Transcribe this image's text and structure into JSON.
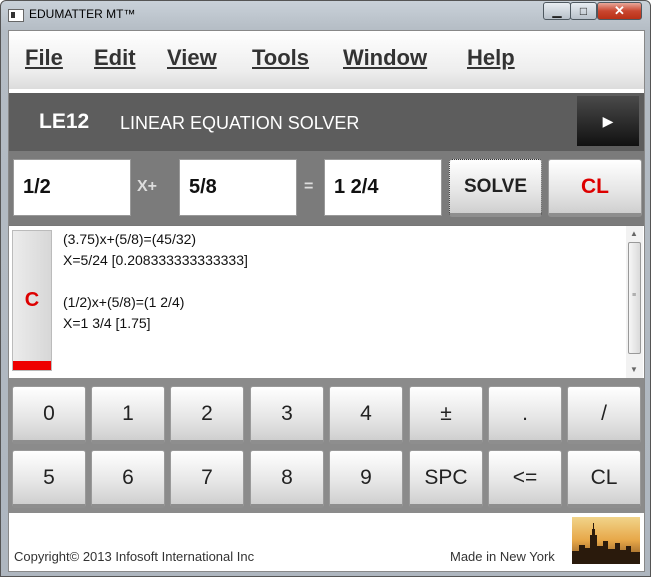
{
  "window": {
    "title": "EDUMATTER MT™",
    "controls": {
      "minimize": "▁",
      "maximize": "□",
      "close": "✕"
    }
  },
  "menu": [
    "File",
    "Edit",
    "View",
    "Tools",
    "Window",
    "Help"
  ],
  "header": {
    "code": "LE12",
    "name": "LINEAR EQUATION SOLVER",
    "next_icon": "▶"
  },
  "equation": {
    "a": "1/2",
    "x_op": "X+",
    "b": "5/8",
    "eq_op": "=",
    "c": "1 2/4",
    "solve_label": "SOLVE",
    "clear_label": "CL"
  },
  "history": {
    "clear_label": "C",
    "lines": [
      "(3.75)x+(5/8)=(45/32)",
      "X=5/24   [0.208333333333333]",
      "",
      "(1/2)x+(5/8)=(1 2/4)",
      "X=1 3/4  [1.75]"
    ]
  },
  "keypad": [
    [
      "0",
      "1",
      "2",
      "3",
      "4",
      "±",
      ".",
      "/"
    ],
    [
      "5",
      "6",
      "7",
      "8",
      "9",
      "SPC",
      "<=",
      "CL"
    ]
  ],
  "footer": {
    "copyright": "Copyright© 2013 Infosoft International Inc",
    "made_in": "Made in New York"
  },
  "colors": {
    "accent_red": "#dd0000",
    "header_bg": "#5d5d5d",
    "input_bg": "#7b7b7b",
    "keypad_bg": "#8b8b8b"
  }
}
